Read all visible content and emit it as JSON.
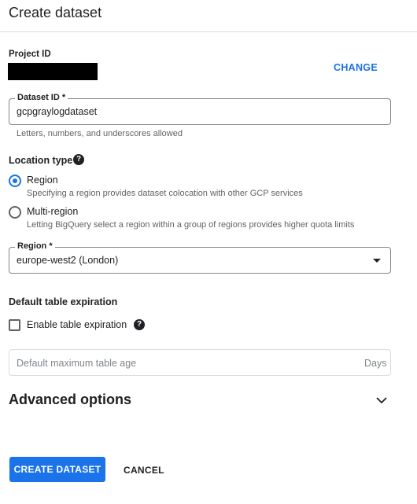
{
  "header": {
    "title": "Create dataset"
  },
  "project": {
    "label": "Project ID",
    "change_label": "CHANGE"
  },
  "dataset_id": {
    "label": "Dataset ID *",
    "value": "gcpgraylogdataset",
    "helper": "Letters, numbers, and underscores allowed"
  },
  "location_type": {
    "label": "Location type",
    "options": [
      {
        "label": "Region",
        "description": "Specifying a region provides dataset colocation with other GCP services",
        "selected": true
      },
      {
        "label": "Multi-region",
        "description": "Letting BigQuery select a region within a group of regions provides higher quota limits",
        "selected": false
      }
    ]
  },
  "region": {
    "label": "Region *",
    "value": "europe-west2 (London)"
  },
  "expiration": {
    "title": "Default table expiration",
    "checkbox_label": "Enable table expiration",
    "checked": false,
    "age_placeholder": "Default maximum table age",
    "age_suffix": "Days"
  },
  "advanced": {
    "title": "Advanced options"
  },
  "actions": {
    "create_label": "CREATE DATASET",
    "cancel_label": "CANCEL"
  },
  "colors": {
    "accent": "#1a73e8",
    "text": "#202124",
    "muted": "#5f6368",
    "border": "#80868b"
  },
  "icons": {
    "help": "help-icon",
    "dropdown": "caret-down-icon",
    "expand": "chevron-down-icon"
  }
}
